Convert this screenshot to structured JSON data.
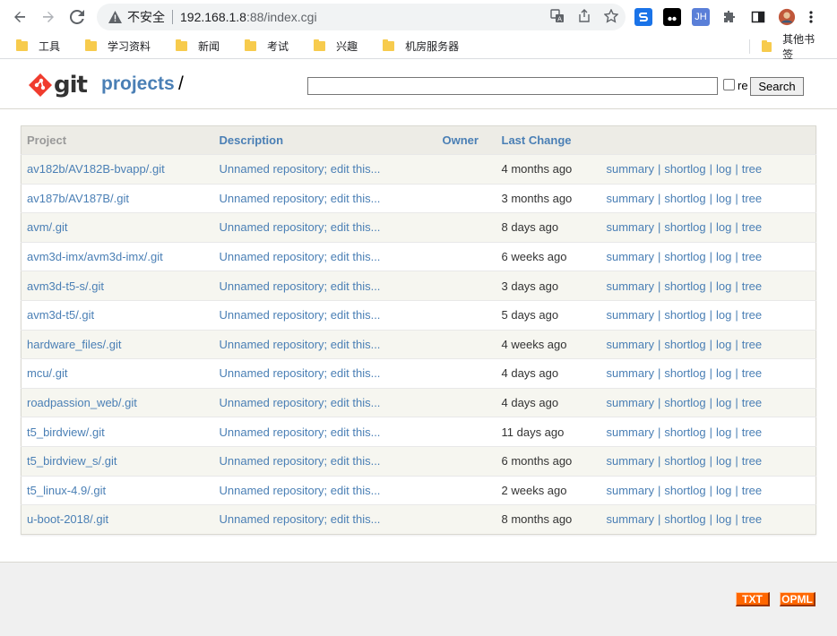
{
  "browser": {
    "security_label": "不安全",
    "url_host": "192.168.1.8",
    "url_path": ":88/index.cgi",
    "bookmarks": [
      "工具",
      "学习资料",
      "新闻",
      "考试",
      "兴趣",
      "机房服务器"
    ],
    "other_bookmarks": "其他书签",
    "ext_jh": "JH"
  },
  "header": {
    "logo_text": "git",
    "projects_label": "projects",
    "slash": "/",
    "search_input_value": "",
    "regex_label": "re",
    "search_button": "Search"
  },
  "table": {
    "headers": {
      "project": "Project",
      "description": "Description",
      "owner": "Owner",
      "last_change": "Last Change"
    },
    "rows": [
      {
        "project": "av182b/AV182B-bvapp/.git",
        "description": "Unnamed repository; edit this...",
        "owner": "",
        "age": "4 months ago"
      },
      {
        "project": "av187b/AV187B/.git",
        "description": "Unnamed repository; edit this...",
        "owner": "",
        "age": "3 months ago"
      },
      {
        "project": "avm/.git",
        "description": "Unnamed repository; edit this...",
        "owner": "",
        "age": "8 days ago"
      },
      {
        "project": "avm3d-imx/avm3d-imx/.git",
        "description": "Unnamed repository; edit this...",
        "owner": "",
        "age": "6 weeks ago"
      },
      {
        "project": "avm3d-t5-s/.git",
        "description": "Unnamed repository; edit this...",
        "owner": "",
        "age": "3 days ago"
      },
      {
        "project": "avm3d-t5/.git",
        "description": "Unnamed repository; edit this...",
        "owner": "",
        "age": "5 days ago"
      },
      {
        "project": "hardware_files/.git",
        "description": "Unnamed repository; edit this...",
        "owner": "",
        "age": "4 weeks ago"
      },
      {
        "project": "mcu/.git",
        "description": "Unnamed repository; edit this...",
        "owner": "",
        "age": "4 days ago"
      },
      {
        "project": "roadpassion_web/.git",
        "description": "Unnamed repository; edit this...",
        "owner": "",
        "age": "4 days ago"
      },
      {
        "project": "t5_birdview/.git",
        "description": "Unnamed repository; edit this...",
        "owner": "",
        "age": "11 days ago"
      },
      {
        "project": "t5_birdview_s/.git",
        "description": "Unnamed repository; edit this...",
        "owner": "",
        "age": "6 months ago"
      },
      {
        "project": "t5_linux-4.9/.git",
        "description": "Unnamed repository; edit this...",
        "owner": "",
        "age": "2 weeks ago"
      },
      {
        "project": "u-boot-2018/.git",
        "description": "Unnamed repository; edit this...",
        "owner": "",
        "age": "8 months ago"
      }
    ],
    "action_links": [
      "summary",
      "shortlog",
      "log",
      "tree"
    ],
    "action_separator": "|"
  },
  "footer": {
    "txt_label": "TXT",
    "opml_label": "OPML"
  },
  "colors": {
    "link": "#4a7fb5",
    "header_bg": "#edece6",
    "row_alt": "#f6f6f0",
    "feed_orange": "#ff6600",
    "git_red": "#f03c2e"
  }
}
